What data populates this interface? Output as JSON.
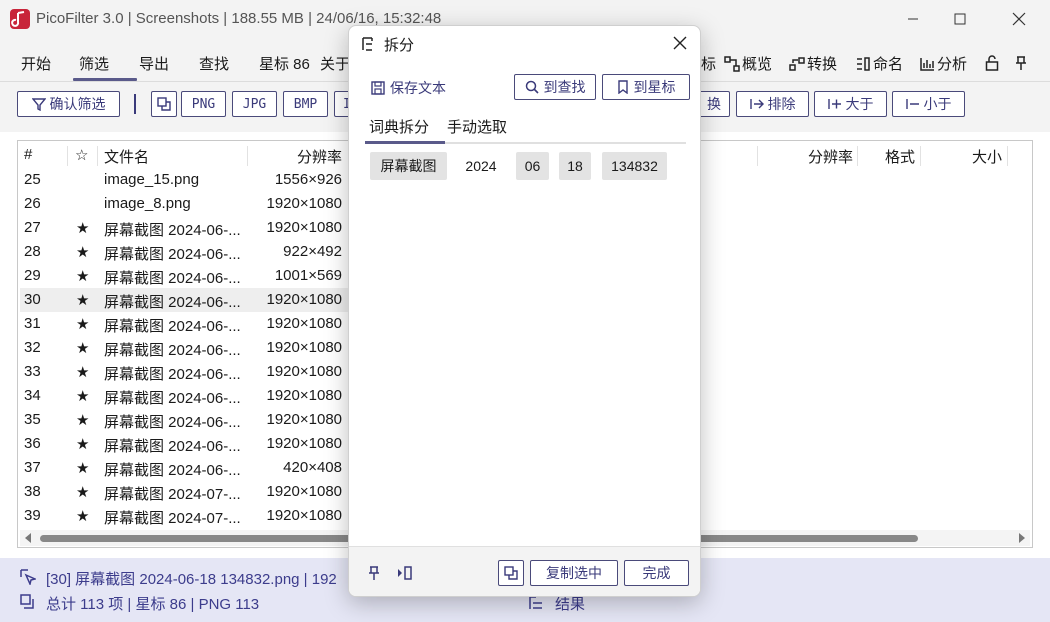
{
  "app": {
    "title": "PicoFilter 3.0 | Screenshots | 188.55 MB | 24/06/16, 15:32:48"
  },
  "menu": {
    "items": [
      "开始",
      "筛选",
      "导出",
      "查找",
      "星标 86",
      "关于"
    ],
    "right_items": [
      "标",
      "概览",
      "转换",
      "命名",
      "分析"
    ]
  },
  "toolbar": {
    "confirm": "确认筛选",
    "formats": [
      "PNG",
      "JPG",
      "BMP",
      "I"
    ],
    "replace": "换",
    "exclude": "排除",
    "greater": "大于",
    "less": "小于"
  },
  "table": {
    "columns": [
      "#",
      "☆",
      "文件名",
      "分辨率"
    ],
    "right_columns": [
      "分辨率",
      "格式",
      "大小"
    ],
    "rows": [
      {
        "num": "25",
        "star": "",
        "name": "image_15.png",
        "res": "1556×926"
      },
      {
        "num": "26",
        "star": "",
        "name": "image_8.png",
        "res": "1920×1080"
      },
      {
        "num": "27",
        "star": "★",
        "name": "屏幕截图 2024-06-...",
        "res": "1920×1080"
      },
      {
        "num": "28",
        "star": "★",
        "name": "屏幕截图 2024-06-...",
        "res": "922×492"
      },
      {
        "num": "29",
        "star": "★",
        "name": "屏幕截图 2024-06-...",
        "res": "1001×569"
      },
      {
        "num": "30",
        "star": "★",
        "name": "屏幕截图 2024-06-...",
        "res": "1920×1080"
      },
      {
        "num": "31",
        "star": "★",
        "name": "屏幕截图 2024-06-...",
        "res": "1920×1080"
      },
      {
        "num": "32",
        "star": "★",
        "name": "屏幕截图 2024-06-...",
        "res": "1920×1080"
      },
      {
        "num": "33",
        "star": "★",
        "name": "屏幕截图 2024-06-...",
        "res": "1920×1080"
      },
      {
        "num": "34",
        "star": "★",
        "name": "屏幕截图 2024-06-...",
        "res": "1920×1080"
      },
      {
        "num": "35",
        "star": "★",
        "name": "屏幕截图 2024-06-...",
        "res": "1920×1080"
      },
      {
        "num": "36",
        "star": "★",
        "name": "屏幕截图 2024-06-...",
        "res": "1920×1080"
      },
      {
        "num": "37",
        "star": "★",
        "name": "屏幕截图 2024-06-...",
        "res": "420×408"
      },
      {
        "num": "38",
        "star": "★",
        "name": "屏幕截图 2024-07-...",
        "res": "1920×1080"
      },
      {
        "num": "39",
        "star": "★",
        "name": "屏幕截图 2024-07-...",
        "res": "1920×1080"
      }
    ]
  },
  "status": {
    "current": "[30] 屏幕截图 2024-06-18 134832.png | 192",
    "summary": "总计 113 项 | 星标 86 | PNG 113",
    "result": "结果"
  },
  "dialog": {
    "title": "拆分",
    "save_text": "保存文本",
    "to_find": "到查找",
    "to_star": "到星标",
    "tabs": [
      "词典拆分",
      "手动选取"
    ],
    "tokens": [
      "屏幕截图",
      "2024",
      "06",
      "18",
      "134832"
    ],
    "copy_selected": "复制选中",
    "done": "完成"
  },
  "colors": {
    "accent": "#3a3a7a",
    "status_bg": "#e5e6f5",
    "brand": "#c8253a"
  }
}
